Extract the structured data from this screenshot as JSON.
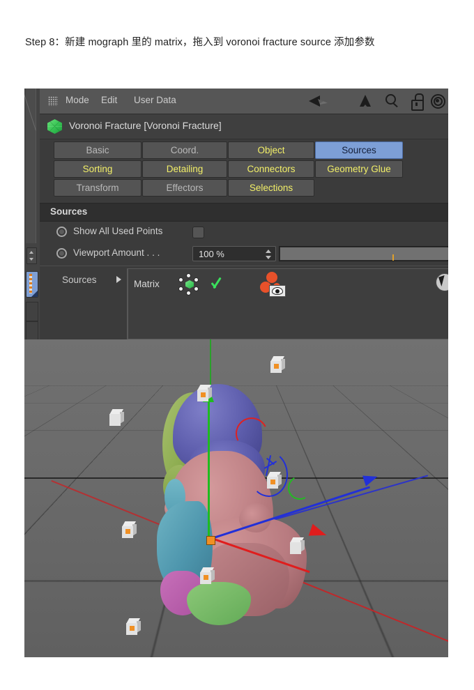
{
  "caption": {
    "text": "Step 8：新建 mograph 里的 matrix，拖入到 voronoi fracture source 添加参数"
  },
  "attribute_manager": {
    "menu": {
      "grip_icon": "grip-dots-icon",
      "items": [
        "Mode",
        "Edit",
        "User Data"
      ],
      "toolbar_icons": [
        "back-arrow-icon",
        "up-arrow-icon",
        "search-icon",
        "lock-icon",
        "target-icon",
        "new-tab-icon"
      ]
    },
    "object": {
      "icon": "voronoi-fracture-icon",
      "title": "Voronoi Fracture [Voronoi Fracture]"
    },
    "tabs": [
      {
        "label": "Basic",
        "style": "normal",
        "active": false
      },
      {
        "label": "Coord.",
        "style": "normal",
        "active": false
      },
      {
        "label": "Object",
        "style": "yellow",
        "active": false
      },
      {
        "label": "Sources",
        "style": "normal",
        "active": true
      },
      {
        "label": "Sorting",
        "style": "yellow",
        "active": false
      },
      {
        "label": "Detailing",
        "style": "yellow",
        "active": false
      },
      {
        "label": "Connectors",
        "style": "yellow",
        "active": false
      },
      {
        "label": "Geometry Glue",
        "style": "yellow",
        "active": false
      },
      {
        "label": "Transform",
        "style": "normal",
        "active": false
      },
      {
        "label": "Effectors",
        "style": "normal",
        "active": false
      },
      {
        "label": "Selections",
        "style": "yellow",
        "active": false
      }
    ],
    "group_header": "Sources",
    "params": [
      {
        "label": "Show All Used Points",
        "control": "checkbox",
        "checked": false
      },
      {
        "label": "Viewport Amount . . .",
        "control": "number-slider",
        "value": "100 %"
      }
    ],
    "sources": {
      "label": "Sources",
      "expander_icon": "triangle-right-icon",
      "items": [
        {
          "name": "Matrix",
          "object_icon": "matrix-object-icon",
          "enabled_icon": "green-check-icon",
          "visibility_icon": "visibility-eye-icon"
        }
      ],
      "cursor_icon": "mouse-cursor-icon"
    }
  },
  "viewport": {
    "gizmo": {
      "origin_icon": "move-gizmo-origin",
      "axes": [
        {
          "name": "x-axis-handle",
          "color": "#e01d1d"
        },
        {
          "name": "y-axis-handle",
          "color": "#1fbb1f"
        },
        {
          "name": "z-axis-handle",
          "color": "#2230d8"
        }
      ],
      "rotation_bands": [
        "red-rotation-arc",
        "blue-rotation-arc",
        "green-rotation-arc"
      ]
    },
    "world_axes": [
      {
        "name": "world-x-axis",
        "color": "#c0282a"
      },
      {
        "name": "world-y-axis",
        "color": "#2aa02a"
      },
      {
        "name": "world-z-axis",
        "color": "#2d34c7"
      }
    ],
    "model": {
      "name": "fractured-head-model",
      "fragments": [
        {
          "name": "crown-fragment",
          "color": "#5f5fae"
        },
        {
          "name": "temple-fragment",
          "color": "#8fae52"
        },
        {
          "name": "face-fragment",
          "color": "#bf8286"
        },
        {
          "name": "jaw-fragment",
          "color": "#b87b80"
        },
        {
          "name": "cheek-fragment",
          "color": "#4e96ad"
        },
        {
          "name": "chin-fragment",
          "color": "#ac52a0"
        },
        {
          "name": "neck-fragment",
          "color": "#63ab57"
        }
      ]
    },
    "matrix_clones": {
      "name": "matrix-clone-cube",
      "count": 8
    },
    "background_color": "#6b6b6b"
  }
}
